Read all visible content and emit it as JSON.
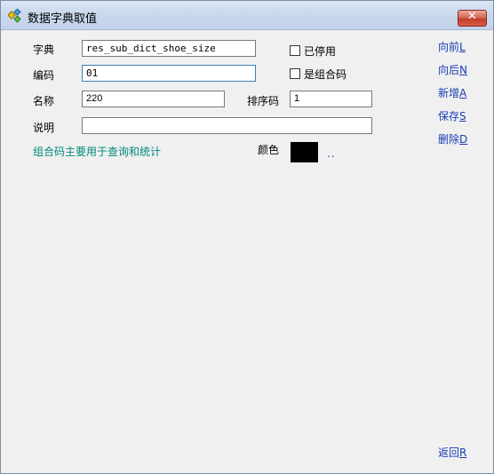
{
  "window": {
    "title": "数据字典取值",
    "close_symbol": "✕"
  },
  "form": {
    "dict_label": "字典",
    "dict_value": "res_sub_dict_shoe_size",
    "code_label": "编码",
    "code_value": "01",
    "name_label": "名称",
    "name_value": "220",
    "sort_label": "排序码",
    "sort_value": "1",
    "desc_label": "说明",
    "desc_value": "",
    "disabled_label": "已停用",
    "combo_label": "是组合码",
    "hint": "组合码主要用于查询和统计",
    "color_label": "颜色",
    "color_value": "#000000",
    "color_picker": ".."
  },
  "buttons": {
    "prev": {
      "label": "向前",
      "key": "L"
    },
    "next": {
      "label": "向后",
      "key": "N"
    },
    "add": {
      "label": "新增",
      "key": "A"
    },
    "save": {
      "label": "保存",
      "key": "S"
    },
    "delete": {
      "label": "删除",
      "key": "D"
    },
    "back": {
      "label": "返回",
      "key": "R"
    }
  }
}
